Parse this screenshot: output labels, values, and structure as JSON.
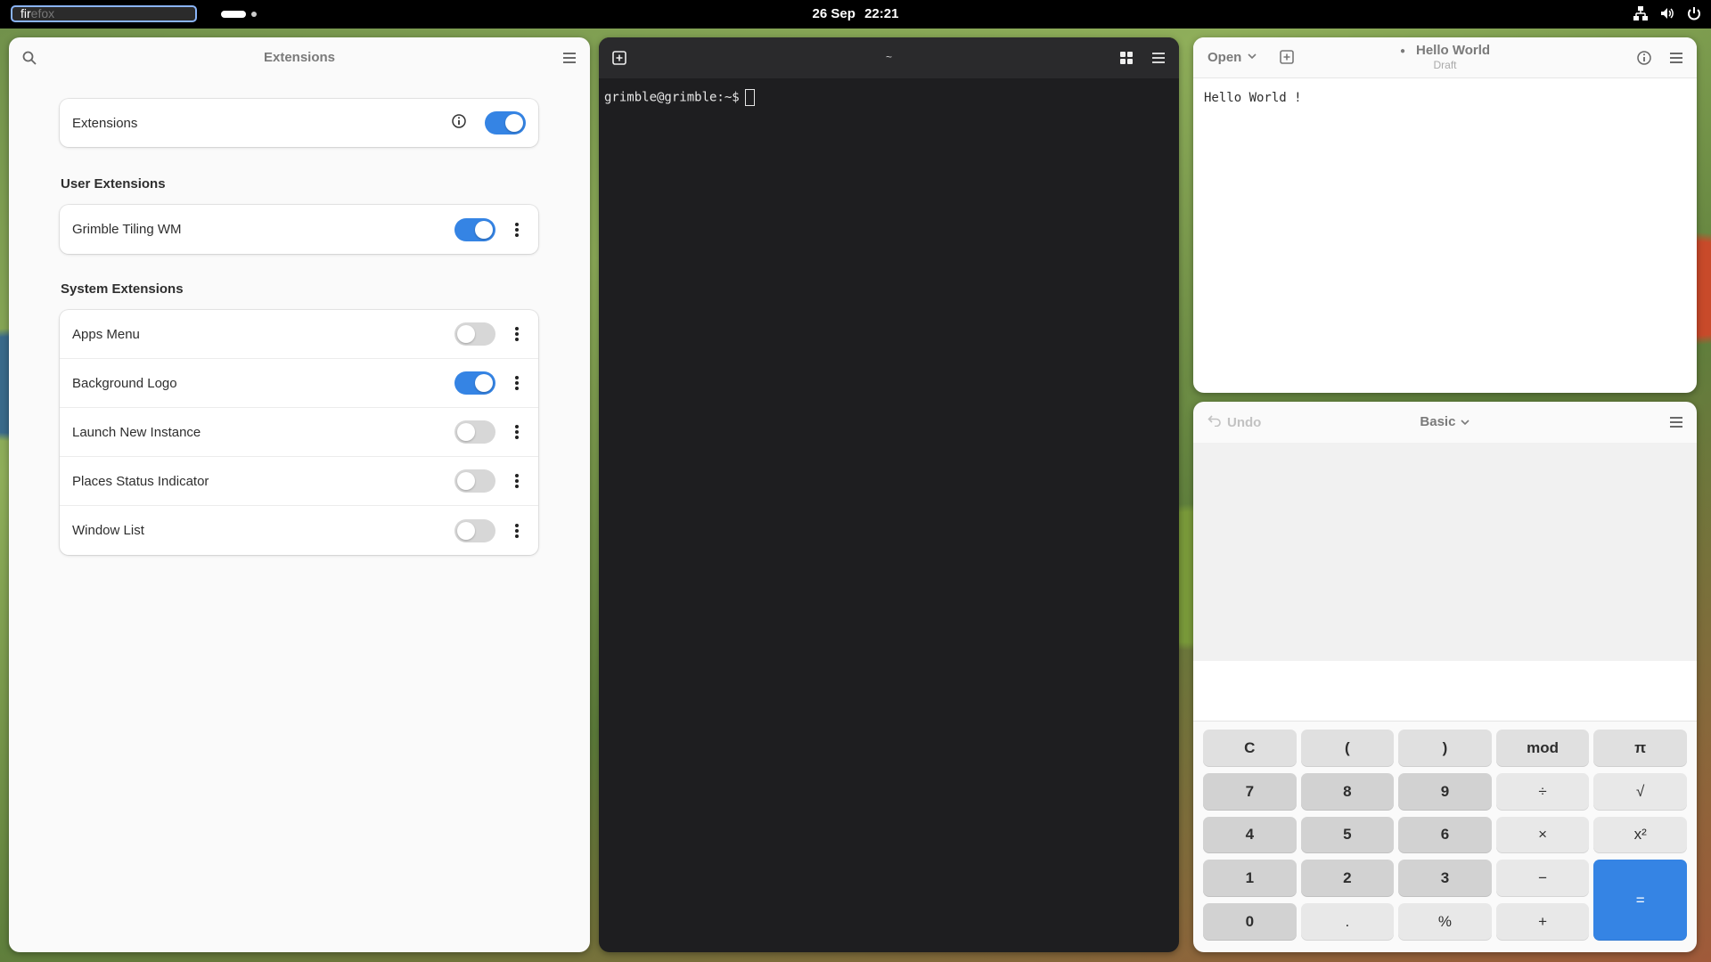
{
  "topbar": {
    "search_typed": "fir",
    "search_completion": "efox",
    "date": "26 Sep",
    "time": "22:21",
    "tray_icons": [
      "network-icon",
      "volume-icon",
      "power-icon"
    ]
  },
  "extensions": {
    "title": "Extensions",
    "main_label": "Extensions",
    "main_enabled": true,
    "user_section_title": "User Extensions",
    "user_items": [
      {
        "label": "Grimble Tiling WM",
        "enabled": true
      }
    ],
    "system_section_title": "System Extensions",
    "system_items": [
      {
        "label": "Apps Menu",
        "enabled": false
      },
      {
        "label": "Background Logo",
        "enabled": true
      },
      {
        "label": "Launch New Instance",
        "enabled": false
      },
      {
        "label": "Places Status Indicator",
        "enabled": false
      },
      {
        "label": "Window List",
        "enabled": false
      }
    ]
  },
  "terminal": {
    "title": "~",
    "prompt": "grimble@grimble:~$"
  },
  "editor": {
    "open_label": "Open",
    "title": "Hello World",
    "subtitle": "Draft",
    "content": "Hello World !"
  },
  "calculator": {
    "undo_label": "Undo",
    "mode_label": "Basic",
    "keys": [
      [
        "C",
        "(",
        ")",
        "mod",
        "π"
      ],
      [
        "7",
        "8",
        "9",
        "÷",
        "√"
      ],
      [
        "4",
        "5",
        "6",
        "×",
        "x²"
      ],
      [
        "1",
        "2",
        "3",
        "−",
        "="
      ],
      [
        "0",
        ".",
        "%",
        "+"
      ]
    ]
  },
  "colors": {
    "accent": "#3584e4",
    "terminal_bg": "#1e1e20"
  }
}
